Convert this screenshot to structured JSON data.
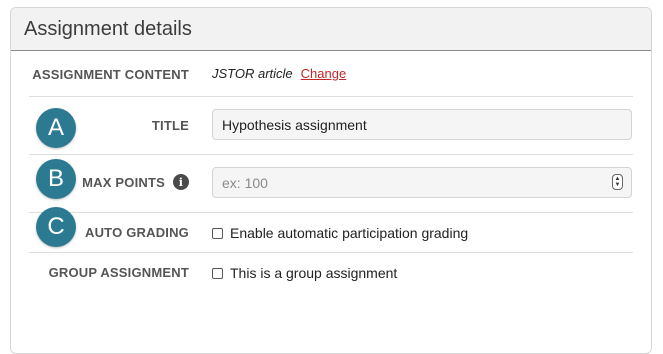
{
  "card": {
    "title": "Assignment details"
  },
  "rows": {
    "content": {
      "label": "ASSIGNMENT CONTENT",
      "value": "JSTOR article",
      "change_link": "Change"
    },
    "title": {
      "label": "TITLE",
      "value": "Hypothesis assignment"
    },
    "max_points": {
      "label": "MAX POINTS",
      "placeholder": "ex: 100",
      "info_icon": "info-icon"
    },
    "auto_grading": {
      "label": "AUTO GRADING",
      "checkbox_label": "Enable automatic participation grading",
      "checked": false
    },
    "group_assignment": {
      "label": "GROUP ASSIGNMENT",
      "checkbox_label": "This is a group assignment",
      "checked": false
    }
  },
  "annotations": {
    "badges": [
      "A",
      "B",
      "C"
    ],
    "color": "#2c7a92"
  },
  "colors": {
    "link": "#c0282d",
    "header_bg": "#f2f2f2"
  }
}
